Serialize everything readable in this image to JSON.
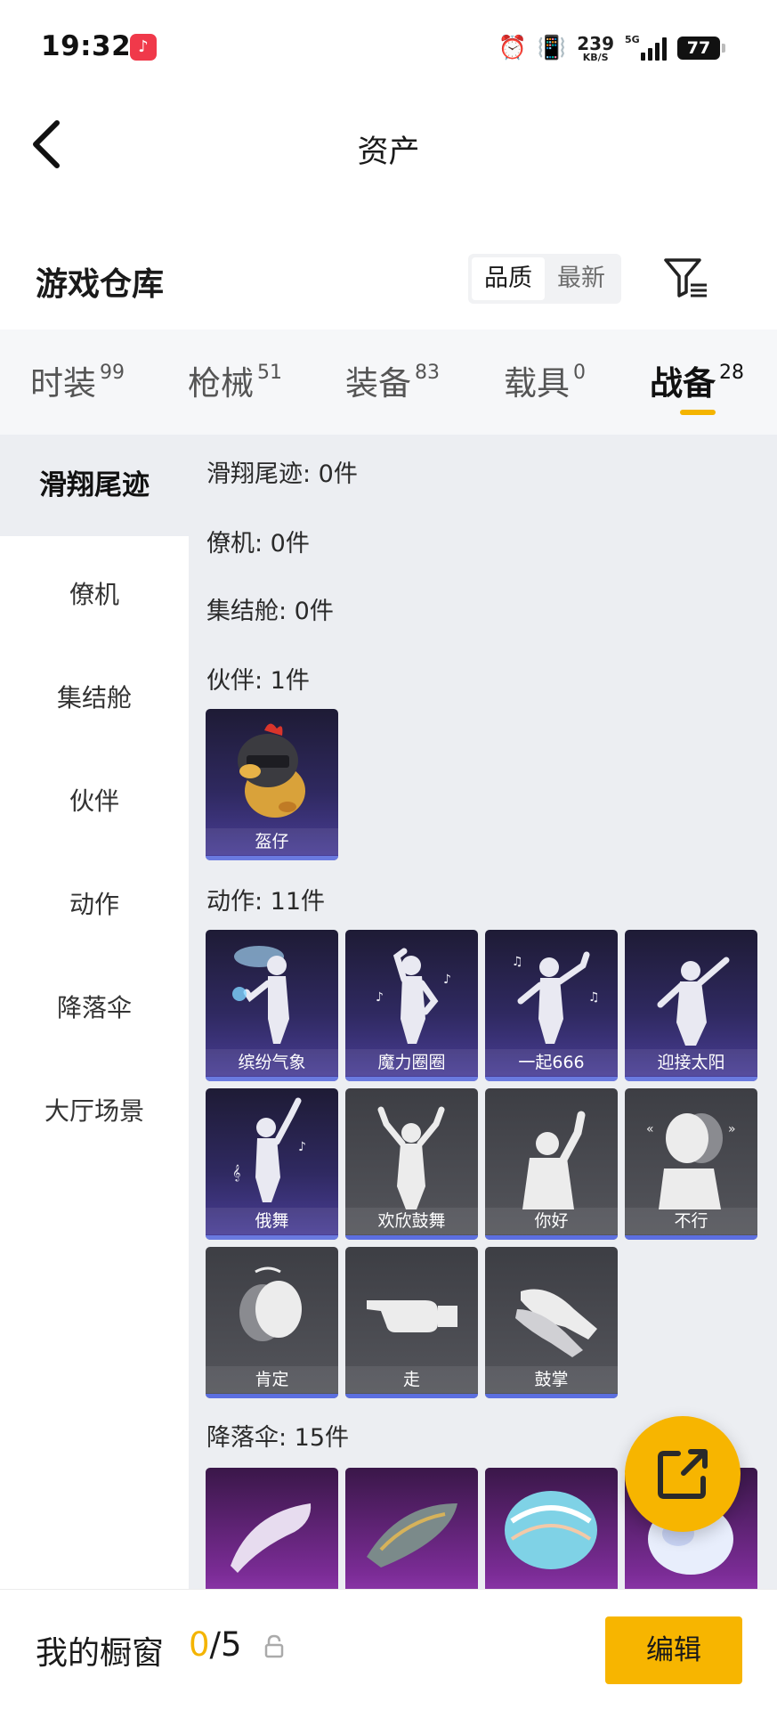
{
  "status_bar": {
    "time": "19:32",
    "net_speed_value": "239",
    "net_speed_unit": "KB/S",
    "network_type": "5G",
    "battery": "77",
    "icons": [
      "music-app-icon",
      "alarm-icon",
      "vibrate-icon",
      "signal-icon",
      "battery-icon"
    ]
  },
  "header": {
    "title": "资产"
  },
  "warehouse": {
    "title": "游戏仓库",
    "sort_options": [
      {
        "label": "品质",
        "active": true
      },
      {
        "label": "最新",
        "active": false
      }
    ]
  },
  "category_tabs": [
    {
      "label": "时装",
      "count": "99",
      "active": false
    },
    {
      "label": "枪械",
      "count": "51",
      "active": false
    },
    {
      "label": "装备",
      "count": "83",
      "active": false
    },
    {
      "label": "载具",
      "count": "0",
      "active": false
    },
    {
      "label": "战备",
      "count": "28",
      "active": true
    }
  ],
  "side_nav": [
    {
      "label": "滑翔尾迹",
      "active": true
    },
    {
      "label": "僚机",
      "active": false
    },
    {
      "label": "集结舱",
      "active": false
    },
    {
      "label": "伙伴",
      "active": false
    },
    {
      "label": "动作",
      "active": false
    },
    {
      "label": "降落伞",
      "active": false
    },
    {
      "label": "大厅场景",
      "active": false
    }
  ],
  "groups": {
    "glide_trail": {
      "label": "滑翔尾迹: 0件"
    },
    "wingman": {
      "label": "僚机: 0件"
    },
    "rally_pod": {
      "label": "集结舱: 0件"
    },
    "partner": {
      "label": "伙伴: 1件",
      "items": [
        "盔仔"
      ]
    },
    "actions": {
      "label": "动作: 11件",
      "items": [
        "缤纷气象",
        "魔力圈圈",
        "一起666",
        "迎接太阳",
        "俄舞",
        "欢欣鼓舞",
        "你好",
        "不行",
        "肯定",
        "走",
        "鼓掌"
      ]
    },
    "parachute": {
      "label": "降落伞: 15件"
    }
  },
  "bottom_bar": {
    "showcase_label": "我的橱窗",
    "showcase_current": "0",
    "showcase_total": "/5",
    "edit_label": "编辑"
  },
  "colors": {
    "accent": "#f7b500",
    "card_purple": "#2f2960",
    "card_grey": "#4a4b51",
    "card_magenta": "#7b2c96"
  }
}
